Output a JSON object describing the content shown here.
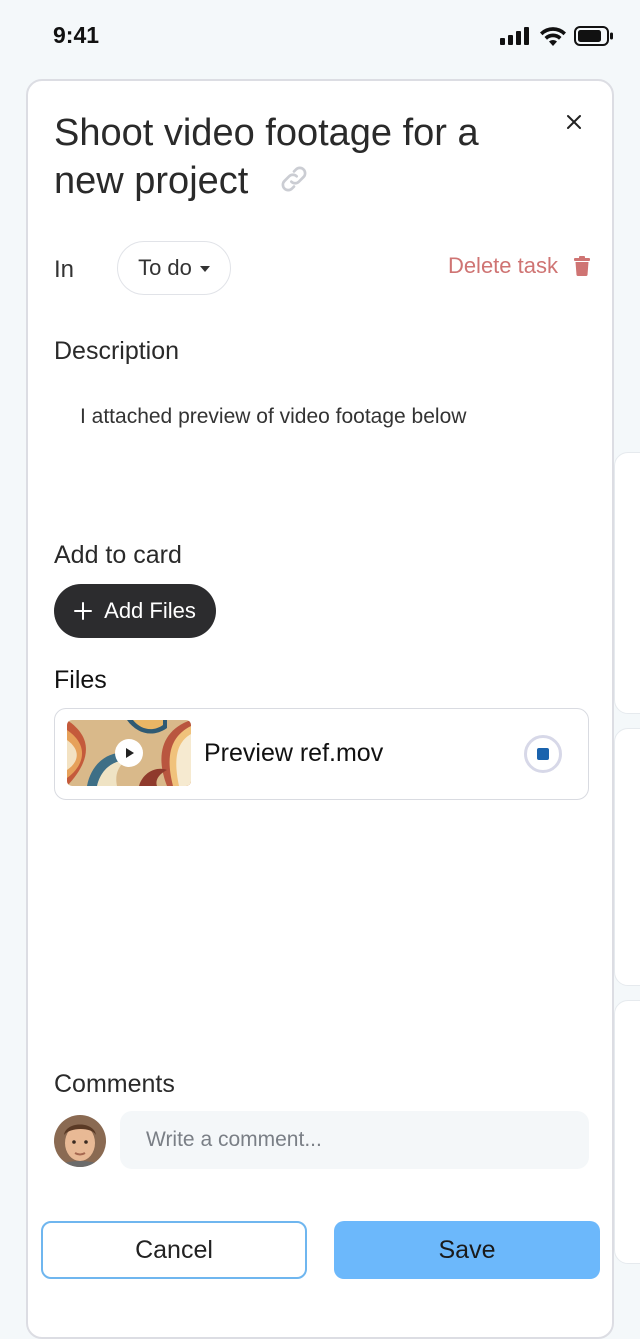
{
  "status_bar": {
    "time": "9:41",
    "icons": [
      "signal-icon",
      "wifi-icon",
      "battery-icon"
    ]
  },
  "task": {
    "title": "Shoot video footage for a new project",
    "in_label": "In",
    "status": "To do",
    "delete_label": "Delete task"
  },
  "description": {
    "label": "Description",
    "text": "I attached preview of video footage below"
  },
  "add_to_card": {
    "label": "Add to card",
    "add_files_label": "Add Files"
  },
  "files": {
    "label": "Files",
    "items": [
      {
        "name": "Preview ref.mov"
      }
    ]
  },
  "comments": {
    "label": "Comments",
    "placeholder": "Write a comment..."
  },
  "actions": {
    "cancel_label": "Cancel",
    "save_label": "Save"
  },
  "colors": {
    "delete": "#cf7473",
    "primary": "#6cb8fb",
    "dark_button": "#2c2c2e",
    "stop": "#1a63ad"
  }
}
